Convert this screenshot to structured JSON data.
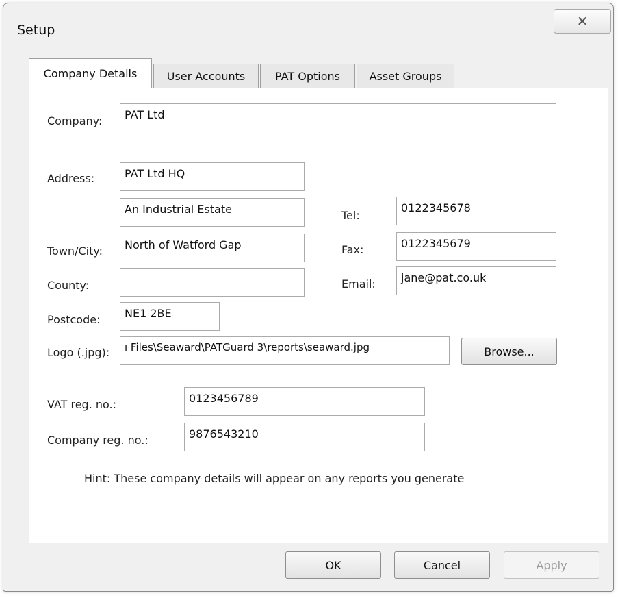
{
  "window": {
    "title": "Setup",
    "close_glyph": "✕"
  },
  "tabs": [
    {
      "label": "Company Details",
      "active": true
    },
    {
      "label": "User Accounts",
      "active": false
    },
    {
      "label": "PAT Options",
      "active": false
    },
    {
      "label": "Asset Groups",
      "active": false
    }
  ],
  "form": {
    "company_label": "Company:",
    "company_value": "PAT Ltd",
    "address_label": "Address:",
    "address1_value": "PAT Ltd HQ",
    "address2_value": "An Industrial Estate",
    "town_label": "Town/City:",
    "town_value": "North of Watford Gap",
    "county_label": "County:",
    "county_value": "",
    "postcode_label": "Postcode:",
    "postcode_value": "NE1 2BE",
    "tel_label": "Tel:",
    "tel_value": "0122345678",
    "fax_label": "Fax:",
    "fax_value": "0122345679",
    "email_label": "Email:",
    "email_value": "jane@pat.co.uk",
    "logo_label": "Logo (.jpg):",
    "logo_value": "ı Files\\Seaward\\PATGuard 3\\reports\\seaward.jpg",
    "browse_label": "Browse...",
    "vat_label": "VAT reg. no.:",
    "vat_value": "0123456789",
    "company_reg_label": "Company reg. no.:",
    "company_reg_value": "9876543210",
    "hint": "Hint: These company details will appear on any reports you generate"
  },
  "buttons": {
    "ok": "OK",
    "cancel": "Cancel",
    "apply": "Apply"
  },
  "colors": {
    "dialog_background": "#f0f0f0",
    "panel_background": "#ffffff",
    "disabled_text": "#9b9b9b"
  }
}
